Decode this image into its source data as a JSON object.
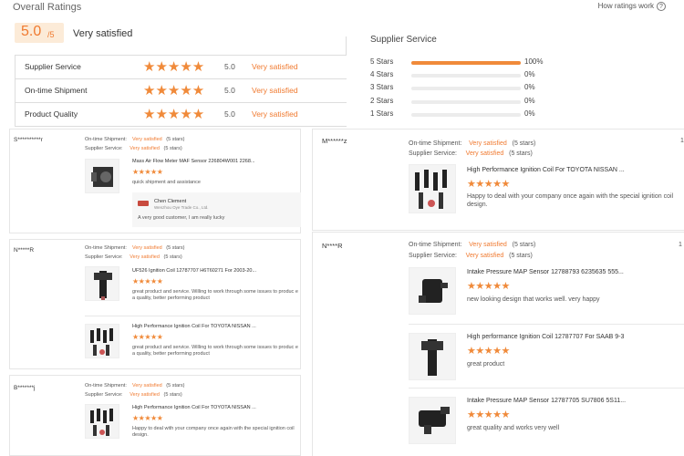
{
  "header": {
    "title": "Overall Ratings",
    "help_link": "How ratings work",
    "help_icon": "?",
    "score": "5.0",
    "score_denominator": "/5",
    "score_text": "Very satisfied"
  },
  "summary": [
    {
      "label": "Supplier Service",
      "stars": "★★★★★",
      "score": "5.0",
      "status": "Very satisfied"
    },
    {
      "label": "On-time Shipment",
      "stars": "★★★★★",
      "score": "5.0",
      "status": "Very satisfied"
    },
    {
      "label": "Product Quality",
      "stars": "★★★★★",
      "score": "5.0",
      "status": "Very satisfied"
    }
  ],
  "breakdown": {
    "title": "Supplier Service",
    "rows": [
      {
        "label": "5  Stars",
        "pct": "100%",
        "fill": 1.0
      },
      {
        "label": "4  Stars",
        "pct": "0%",
        "fill": 0
      },
      {
        "label": "3  Stars",
        "pct": "0%",
        "fill": 0
      },
      {
        "label": "2  Stars",
        "pct": "0%",
        "fill": 0
      },
      {
        "label": "1  Stars",
        "pct": "0%",
        "fill": 0
      }
    ],
    "accent": "#f08a3a"
  },
  "meta": {
    "shipment_label": "On-time Shipment:",
    "service_label": "Supplier Service:",
    "value": "Very satisfied",
    "stars_text": "(5 stars)"
  },
  "left_reviews": [
    {
      "user": "S**********r",
      "products": [
        {
          "name": "Mass Air Flow Meter MAF Sensor 226804W001 2268...",
          "stars": "★★★★★",
          "comment": "quick shipment and assistance"
        }
      ],
      "reply": {
        "name": "Chen Clement",
        "company": "Wenzhou Oye Trade Co., Ltd.",
        "message": "A very good customer, I am really lucky"
      }
    },
    {
      "user": "N*****R",
      "products": [
        {
          "name": "UF526 Ignition Coil 12787707 H6T60271 For 2003-20...",
          "stars": "★★★★★",
          "comment": "great product and service. Willing to work through some issues to produc e a quality, better performing product"
        },
        {
          "name": "High Performance Ignition Coil For TOYOTA NISSAN ...",
          "stars": "★★★★★",
          "comment": "great product and service. Willing to work through some issues to produc e a quality, better performing product"
        }
      ]
    },
    {
      "user": "B*******j",
      "products": [
        {
          "name": "High Performance Ignition Coil For TOYOTA NISSAN ...",
          "stars": "★★★★★",
          "comment": "Happy to deal with your company once again with the special ignition coil design."
        }
      ]
    }
  ],
  "right_reviews": [
    {
      "user": "M******z",
      "corner": "1",
      "products": [
        {
          "name": "High Performance Ignition Coil For TOYOTA NISSAN ...",
          "stars": "★★★★★",
          "comment": "Happy to deal with your company once again with the special ignition coil design."
        }
      ]
    },
    {
      "user": "N****R",
      "corner": "1",
      "products": [
        {
          "name": "Intake Pressure MAP Sensor 12788793 6235635 555...",
          "stars": "★★★★★",
          "comment": "new looking design that works well. very happy"
        },
        {
          "name": "High performance Ignition Coil 12787707 For SAAB 9-3",
          "stars": "★★★★★",
          "comment": "great product"
        },
        {
          "name": "Intake Pressure MAP Sensor 12787705 SU7806 5S11...",
          "stars": "★★★★★",
          "comment": "great quality and works very well"
        }
      ]
    }
  ]
}
